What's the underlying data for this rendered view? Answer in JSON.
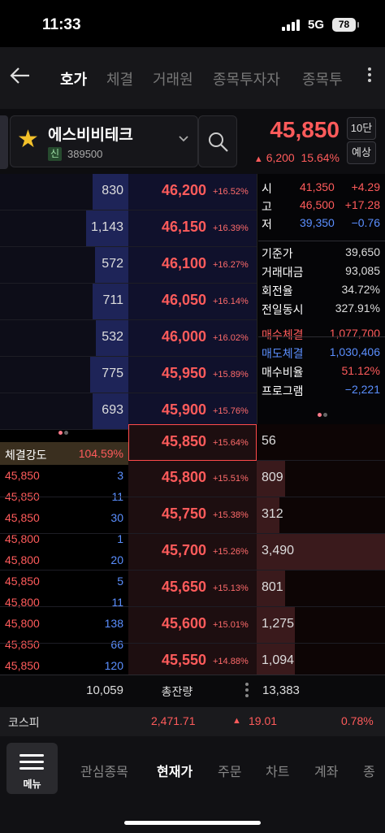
{
  "status": {
    "time": "11:33",
    "network": "5G",
    "battery": "78"
  },
  "nav": {
    "tabs": [
      "호가",
      "체결",
      "거래원",
      "종목투자자",
      "종목투"
    ]
  },
  "stock": {
    "name": "에스비비테크",
    "market_badge": "신",
    "code": "389500",
    "price": "45,850",
    "change_arrow": "▲",
    "change": "6,200",
    "change_pct": "15.64%",
    "levels_btn": "10단",
    "forecast_btn": "예상"
  },
  "asks": [
    {
      "qty": "830",
      "price": "46,200",
      "pct": "+16.52%",
      "fill": 0.28
    },
    {
      "qty": "1,143",
      "price": "46,150",
      "pct": "+16.39%",
      "fill": 0.33
    },
    {
      "qty": "572",
      "price": "46,100",
      "pct": "+16.27%",
      "fill": 0.26
    },
    {
      "qty": "711",
      "price": "46,050",
      "pct": "+16.14%",
      "fill": 0.28
    },
    {
      "qty": "532",
      "price": "46,000",
      "pct": "+16.02%",
      "fill": 0.25
    },
    {
      "qty": "775",
      "price": "45,950",
      "pct": "+15.89%",
      "fill": 0.3
    },
    {
      "qty": "693",
      "price": "45,900",
      "pct": "+15.76%",
      "fill": 0.28
    }
  ],
  "info": {
    "ohl": [
      {
        "label": "시",
        "price": "41,350",
        "pct": "+4.29",
        "color": "#ff5b5b"
      },
      {
        "label": "고",
        "price": "46,500",
        "pct": "+17.28",
        "color": "#ff5b5b"
      },
      {
        "label": "저",
        "price": "39,350",
        "pct": "−0.76",
        "color": "#5b8fff"
      }
    ],
    "stats": [
      {
        "label": "기준가",
        "value": "39,650",
        "color": "#ddd"
      },
      {
        "label": "거래대금",
        "value": "93,085",
        "color": "#ddd"
      },
      {
        "label": "회전율",
        "value": "34.72%",
        "color": "#ddd"
      },
      {
        "label": "전일동시",
        "value": "327.91%",
        "color": "#ddd"
      }
    ],
    "flows": [
      {
        "label": "매수체결",
        "value": "1,077,700",
        "label_color": "#ff5b5b",
        "color": "#ff5b5b"
      },
      {
        "label": "매도체결",
        "value": "1,030,406",
        "label_color": "#5b8fff",
        "color": "#5b8fff"
      },
      {
        "label": "매수비율",
        "value": "51.12%",
        "label_color": "#fff",
        "color": "#ff5b5b"
      },
      {
        "label": "프로그램",
        "value": "−2,221",
        "label_color": "#fff",
        "color": "#5b8fff"
      }
    ]
  },
  "current": {
    "price": "45,850",
    "pct": "+15.64%",
    "qty": "56"
  },
  "strength": {
    "label": "체결강도",
    "value": "104.59%"
  },
  "trades": [
    {
      "price": "45,850",
      "qty": "3"
    },
    {
      "price": "45,850",
      "qty": "11"
    },
    {
      "price": "45,850",
      "qty": "30"
    },
    {
      "price": "45,800",
      "qty": "1"
    },
    {
      "price": "45,800",
      "qty": "20"
    },
    {
      "price": "45,850",
      "qty": "5"
    },
    {
      "price": "45,800",
      "qty": "11"
    },
    {
      "price": "45,800",
      "qty": "138"
    },
    {
      "price": "45,850",
      "qty": "66"
    },
    {
      "price": "45,850",
      "qty": "120"
    }
  ],
  "bids": [
    {
      "qty": "809",
      "price": "45,800",
      "pct": "+15.51%",
      "fill": 0.22
    },
    {
      "qty": "312",
      "price": "45,750",
      "pct": "+15.38%",
      "fill": 0.18
    },
    {
      "qty": "3,490",
      "price": "45,700",
      "pct": "+15.26%",
      "fill": 1.0
    },
    {
      "qty": "801",
      "price": "45,650",
      "pct": "+15.13%",
      "fill": 0.22
    },
    {
      "qty": "1,275",
      "price": "45,600",
      "pct": "+15.01%",
      "fill": 0.3
    },
    {
      "qty": "1,094",
      "price": "45,550",
      "pct": "+14.88%",
      "fill": 0.3
    }
  ],
  "totals": {
    "ask_total": "10,059",
    "label": "총잔량",
    "bid_total": "13,383"
  },
  "index": {
    "name": "코스피",
    "value": "2,471.71",
    "arrow": "▲",
    "change": "19.01",
    "pct": "0.78%"
  },
  "bottom": {
    "menu_label": "메뉴",
    "items": [
      "관심종목",
      "현재가",
      "주문",
      "차트",
      "계좌",
      "종"
    ]
  }
}
